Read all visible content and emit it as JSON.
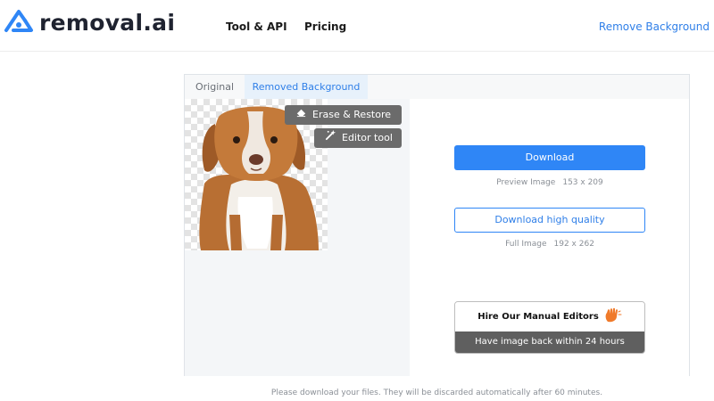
{
  "header": {
    "logo_text": "removal.ai",
    "nav": {
      "tool_api": "Tool & API",
      "pricing": "Pricing"
    },
    "remove_background": "Remove Background"
  },
  "tabs": [
    {
      "label": "Original"
    },
    {
      "label": "Removed Background",
      "active": true
    }
  ],
  "editor": {
    "erase_restore": "Erase & Restore",
    "editor_tool": "Editor tool"
  },
  "downloads": {
    "download_label": "Download",
    "preview_label": "Preview Image",
    "preview_size": "153 x 209",
    "hq_label": "Download high quality",
    "full_label": "Full Image",
    "full_size": "192 x 262"
  },
  "hire": {
    "title": "Hire Our Manual Editors",
    "subtitle": "Have image back within 24 hours"
  },
  "footer_note": "Please download your files. They will be discarded automatically after 60 minutes.",
  "colors": {
    "brand_blue": "#2f86f6",
    "link_blue": "#2f7fe8",
    "gray_button": "#6b6b6b",
    "hand_orange": "#f07a2a"
  },
  "icons": {
    "logo": "removal-logo-icon",
    "erase": "eraser-icon",
    "editor": "magic-wand-icon",
    "hire": "waving-hand-icon"
  }
}
